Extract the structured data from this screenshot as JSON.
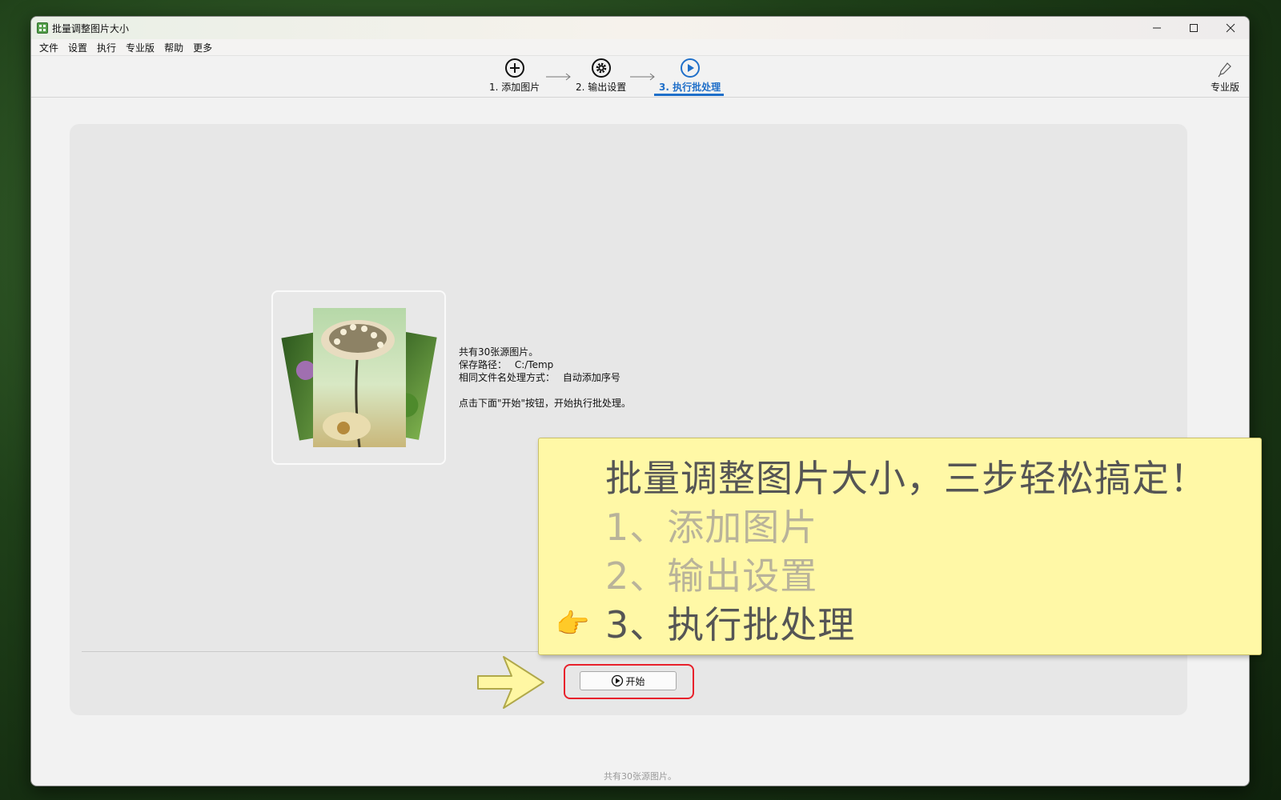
{
  "window": {
    "title": "批量调整图片大小"
  },
  "menu": [
    "文件",
    "设置",
    "执行",
    "专业版",
    "帮助",
    "更多"
  ],
  "steps": [
    {
      "label": "1. 添加图片"
    },
    {
      "label": "2. 输出设置"
    },
    {
      "label": "3. 执行批处理"
    }
  ],
  "pro": {
    "label": "专业版"
  },
  "info": {
    "count": "共有30张源图片。",
    "save_path_label": "保存路径：",
    "save_path": "C:/Temp",
    "same_name_label": "相同文件名处理方式：",
    "same_name_value": "自动添加序号",
    "hint": "点击下面\"开始\"按钮，开始执行批处理。"
  },
  "start_button": {
    "label": "开始"
  },
  "status": {
    "text": "共有30张源图片。"
  },
  "callout": {
    "lines": [
      "批量调整图片大小，三步轻松搞定！",
      "1、添加图片",
      "2、输出设置",
      "3、执行批处理"
    ],
    "pointer": "👉"
  }
}
